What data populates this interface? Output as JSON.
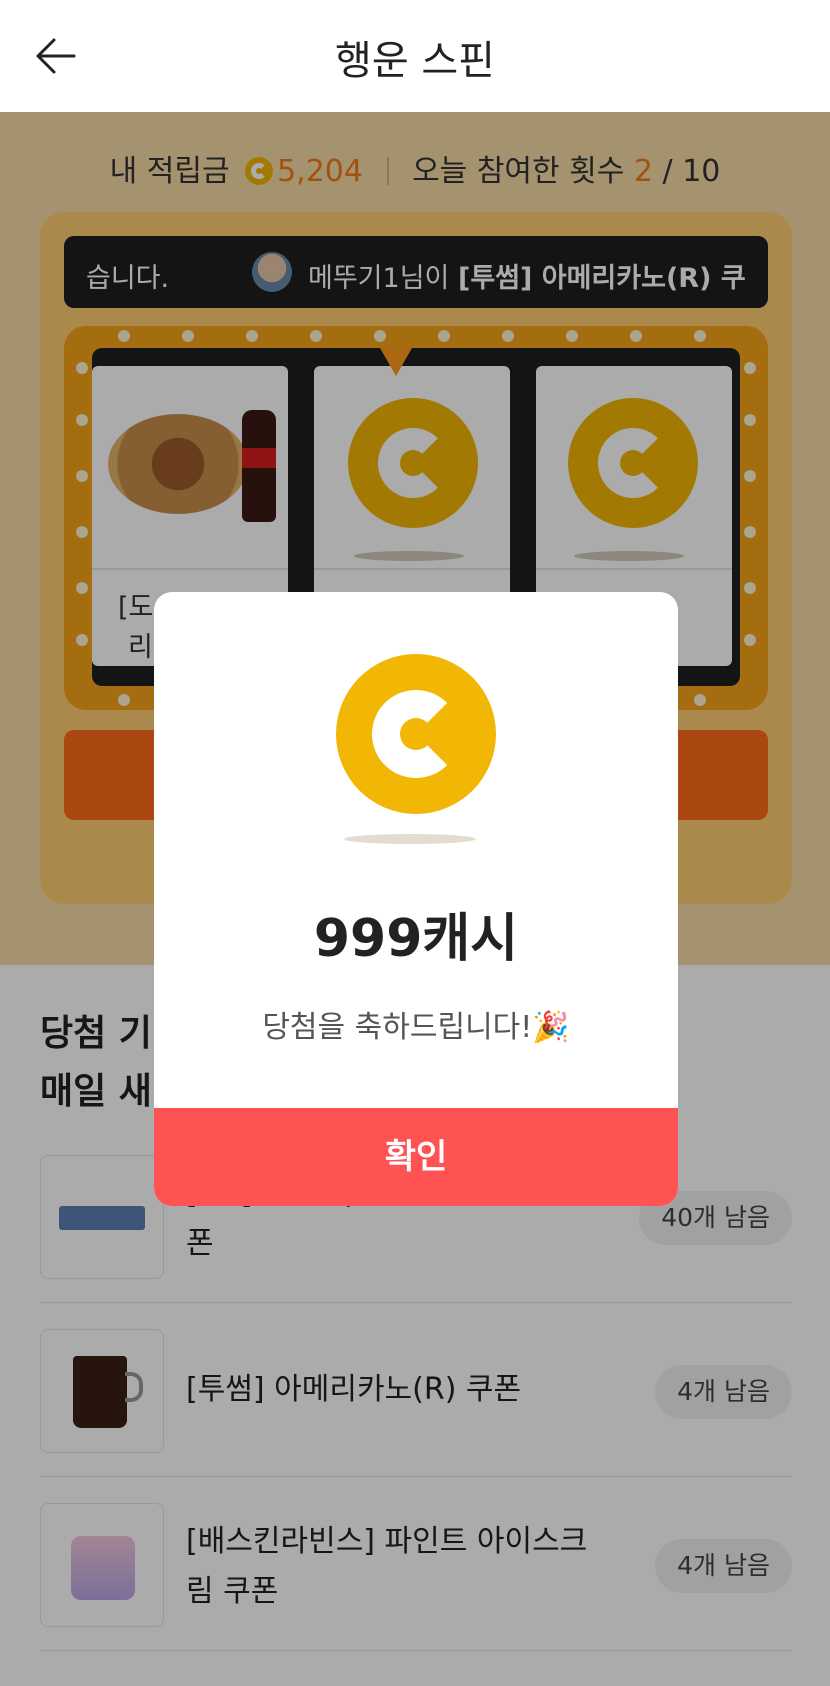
{
  "header": {
    "title": "행운 스핀",
    "back_icon": "arrow-left-icon"
  },
  "stats": {
    "points_label": "내 적립금",
    "points_value": "5,204",
    "participation_label": "오늘 참여한 횟수",
    "participation_current": "2",
    "participation_total": "/ 10"
  },
  "ticker": {
    "left_text": "습니다.",
    "user_text": "메뚜기1님이",
    "item_text": "[투썸] 아메리카노(R) 쿠"
  },
  "reels": {
    "label_1": "[도",
    "label_2": "리"
  },
  "section": {
    "title_line1": "당첨 기",
    "title_line2": "매일 새"
  },
  "items": [
    {
      "name": "[CU] 오리온)닥터유에너지바 쿠폰",
      "remaining": "40개 남음"
    },
    {
      "name": "[투썸] 아메리카노(R) 쿠폰",
      "remaining": "4개 남음"
    },
    {
      "name": "[배스킨라빈스] 파인트 아이스크림 쿠폰",
      "remaining": "4개 남음"
    }
  ],
  "modal": {
    "amount": "999캐시",
    "message": "당첨을 축하드립니다!🎉",
    "confirm_label": "확인"
  },
  "colors": {
    "accent": "#ff5252",
    "coin": "#f2b705",
    "orange": "#f07b1a"
  }
}
